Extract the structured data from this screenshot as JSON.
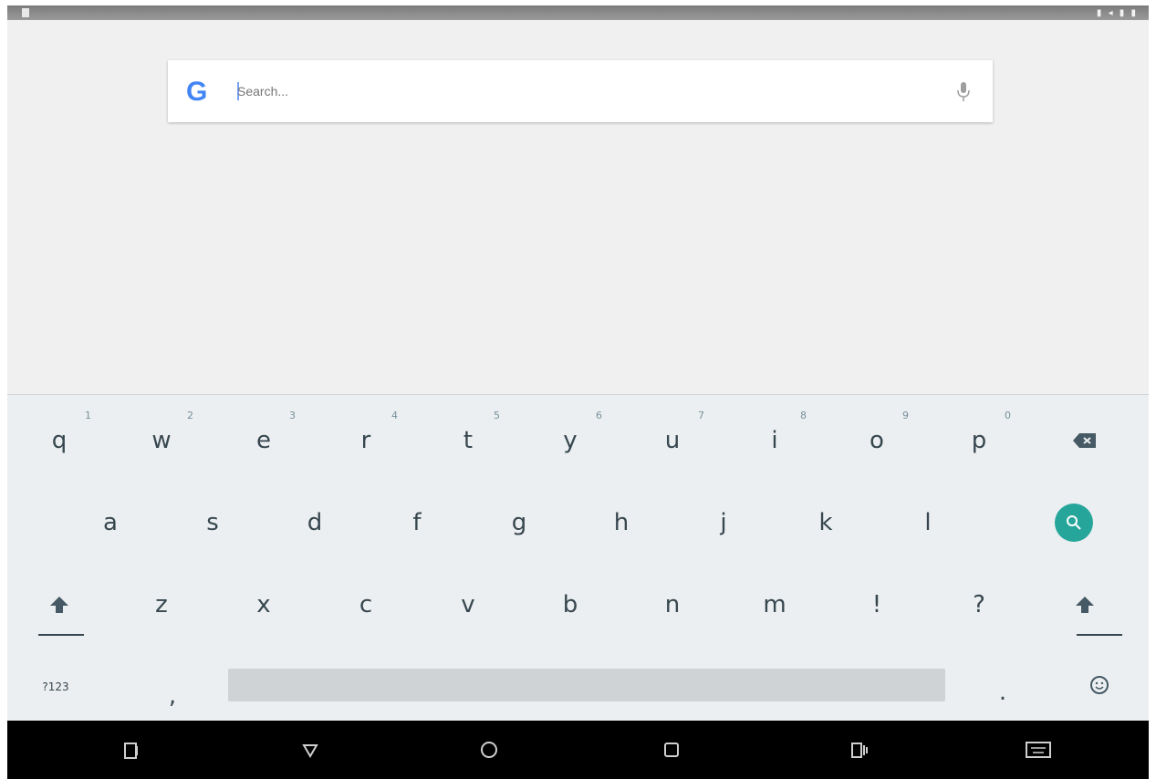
{
  "status_bar": {
    "right_text": "▮ ◂ ▮ ▮"
  },
  "search": {
    "placeholder": "Search..."
  },
  "keyboard": {
    "row1": [
      {
        "label": "q",
        "hint": "1"
      },
      {
        "label": "w",
        "hint": "2"
      },
      {
        "label": "e",
        "hint": "3"
      },
      {
        "label": "r",
        "hint": "4"
      },
      {
        "label": "t",
        "hint": "5"
      },
      {
        "label": "y",
        "hint": "6"
      },
      {
        "label": "u",
        "hint": "7"
      },
      {
        "label": "i",
        "hint": "8"
      },
      {
        "label": "o",
        "hint": "9"
      },
      {
        "label": "p",
        "hint": "0"
      }
    ],
    "row2": [
      "a",
      "s",
      "d",
      "f",
      "g",
      "h",
      "j",
      "k",
      "l"
    ],
    "row3": [
      "z",
      "x",
      "c",
      "v",
      "b",
      "n",
      "m",
      "!",
      "?"
    ],
    "symbols_label": "?123",
    "comma_label": ",",
    "period_label": "."
  },
  "colors": {
    "accent": "#26a69a",
    "nav_bg": "#000000"
  }
}
